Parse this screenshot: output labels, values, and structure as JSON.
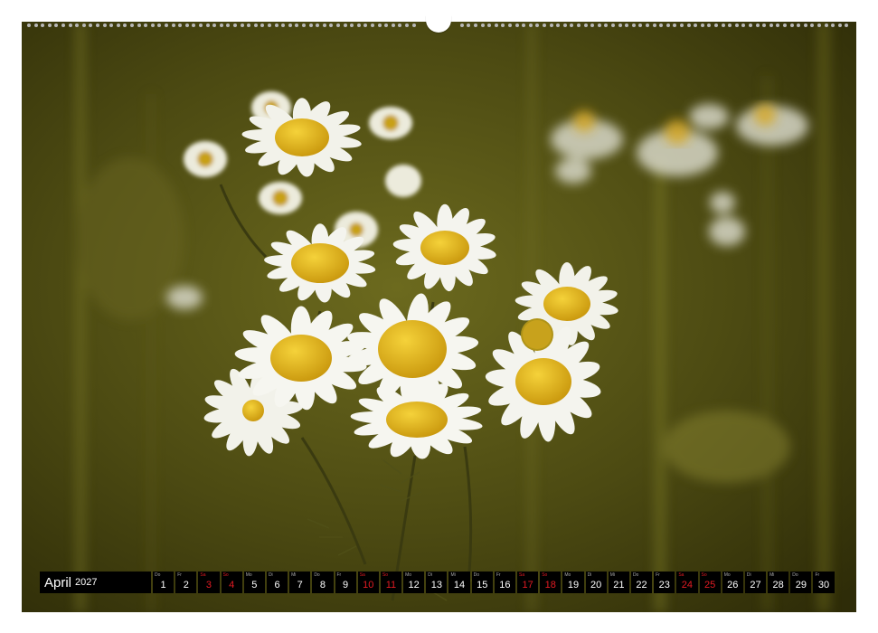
{
  "calendar": {
    "month": "April",
    "year": "2027",
    "days": [
      {
        "wd": "Do",
        "n": "1",
        "red": false
      },
      {
        "wd": "Fr",
        "n": "2",
        "red": false
      },
      {
        "wd": "Sa",
        "n": "3",
        "red": true
      },
      {
        "wd": "So",
        "n": "4",
        "red": true
      },
      {
        "wd": "Mo",
        "n": "5",
        "red": false
      },
      {
        "wd": "Di",
        "n": "6",
        "red": false
      },
      {
        "wd": "Mi",
        "n": "7",
        "red": false
      },
      {
        "wd": "Do",
        "n": "8",
        "red": false
      },
      {
        "wd": "Fr",
        "n": "9",
        "red": false
      },
      {
        "wd": "Sa",
        "n": "10",
        "red": true
      },
      {
        "wd": "So",
        "n": "11",
        "red": true
      },
      {
        "wd": "Mo",
        "n": "12",
        "red": false
      },
      {
        "wd": "Di",
        "n": "13",
        "red": false
      },
      {
        "wd": "Mi",
        "n": "14",
        "red": false
      },
      {
        "wd": "Do",
        "n": "15",
        "red": false
      },
      {
        "wd": "Fr",
        "n": "16",
        "red": false
      },
      {
        "wd": "Sa",
        "n": "17",
        "red": true
      },
      {
        "wd": "So",
        "n": "18",
        "red": true
      },
      {
        "wd": "Mo",
        "n": "19",
        "red": false
      },
      {
        "wd": "Di",
        "n": "20",
        "red": false
      },
      {
        "wd": "Mi",
        "n": "21",
        "red": false
      },
      {
        "wd": "Do",
        "n": "22",
        "red": false
      },
      {
        "wd": "Fr",
        "n": "23",
        "red": false
      },
      {
        "wd": "Sa",
        "n": "24",
        "red": true
      },
      {
        "wd": "So",
        "n": "25",
        "red": true
      },
      {
        "wd": "Mo",
        "n": "26",
        "red": false
      },
      {
        "wd": "Di",
        "n": "27",
        "red": false
      },
      {
        "wd": "Mi",
        "n": "28",
        "red": false
      },
      {
        "wd": "Do",
        "n": "29",
        "red": false
      },
      {
        "wd": "Fr",
        "n": "30",
        "red": false
      }
    ]
  },
  "colors": {
    "background_olive": "#4a4a12",
    "petal": "#f4f4ee",
    "disc": "#e6b415",
    "holiday_red": "#e31b23"
  }
}
